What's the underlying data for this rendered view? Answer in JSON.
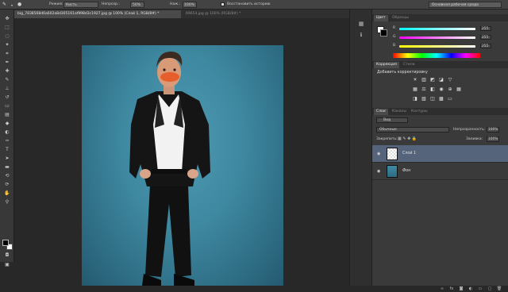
{
  "options": {
    "mode_label": "Режим:",
    "mode_value": "Кисть",
    "opacity_label": "Непрозр.:",
    "opacity_value": "50%",
    "flow_label": "Наж.:",
    "flow_value": "100%",
    "history_label": "Восстановить историю",
    "workspace": "Основная рабочая среда"
  },
  "tabs": [
    {
      "label": "big_7838568d6a602a8d305161af998d3c1927.jpg @ 100% (Слой 1, RGB/8#) *"
    },
    {
      "label": "69654.jpg @ 100% (RGB/8#) *"
    }
  ],
  "color_panel": {
    "tab_color": "Цвет",
    "tab_swatches": "Образцы",
    "r": {
      "label": "R",
      "value": "255"
    },
    "g": {
      "label": "G",
      "value": "255"
    },
    "b": {
      "label": "B",
      "value": "255"
    }
  },
  "adjust_panel": {
    "tab_corrections": "Коррекция",
    "tab_styles": "Стили",
    "add_label": "Добавить корректировку"
  },
  "layers_panel": {
    "tab_layers": "Слои",
    "tab_channels": "Каналы",
    "tab_paths": "Контуры",
    "kind_value": "Вид",
    "blend_value": "Обычные",
    "opacity_label": "Непрозрачность:",
    "opacity_value": "100%",
    "lock_label": "Закрепить:",
    "fill_label": "Заливка:",
    "fill_value": "100%",
    "layers": [
      {
        "name": "Слой 1"
      },
      {
        "name": "Фон"
      }
    ]
  },
  "colors": {
    "accent": "#55647a"
  }
}
